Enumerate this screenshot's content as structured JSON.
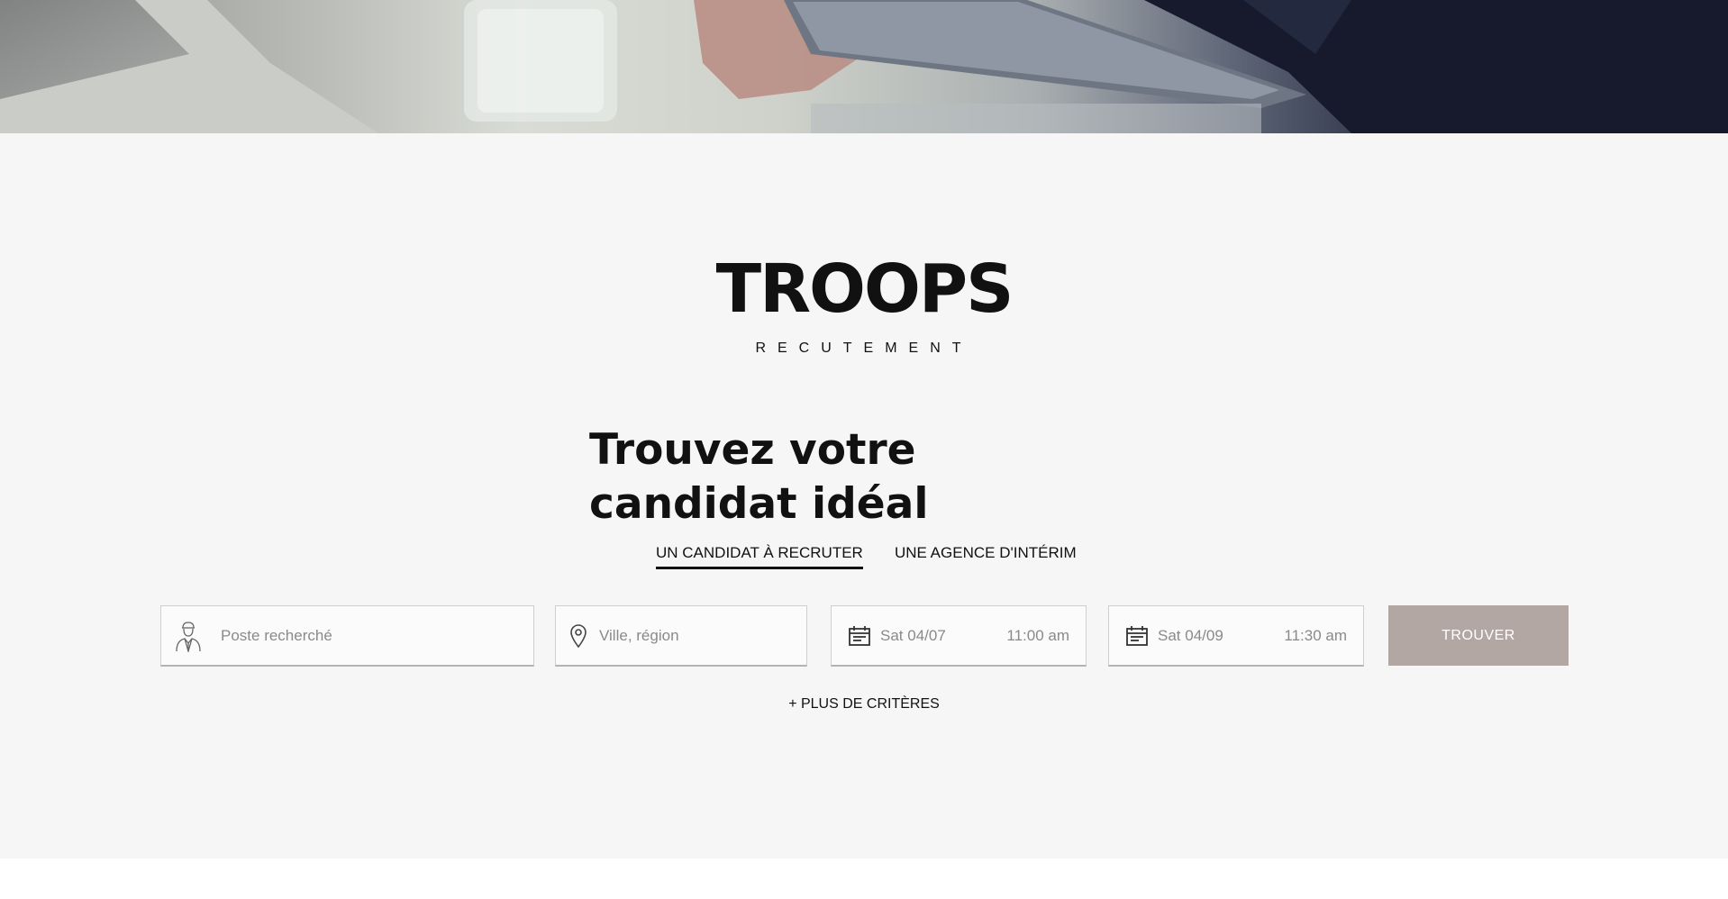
{
  "brand": {
    "name": "TROOPS",
    "tagline": "RECUTEMENT"
  },
  "headline": "Trouvez votre candidat idéal",
  "tabs": [
    {
      "label": "UN CANDIDAT À RECRUTER",
      "active": true
    },
    {
      "label": "UNE AGENCE D'INTÉRIM",
      "active": false
    }
  ],
  "search": {
    "poste_placeholder": "Poste recherché",
    "ville_placeholder": "Ville, région",
    "start": {
      "date": "Sat 04/07",
      "time": "11:00 am"
    },
    "end": {
      "date": "Sat 04/09",
      "time": "11:30 am"
    },
    "submit_label": "TROUVER"
  },
  "more_criteria": "+ PLUS DE CRITÈRES",
  "colors": {
    "panel_bg": "#f6f6f6",
    "button_bg": "#b3a7a3",
    "text": "#111111",
    "placeholder": "#8a8a8a"
  },
  "icons": {
    "poste": "person-icon",
    "ville": "location-pin-icon",
    "date": "calendar-icon"
  }
}
